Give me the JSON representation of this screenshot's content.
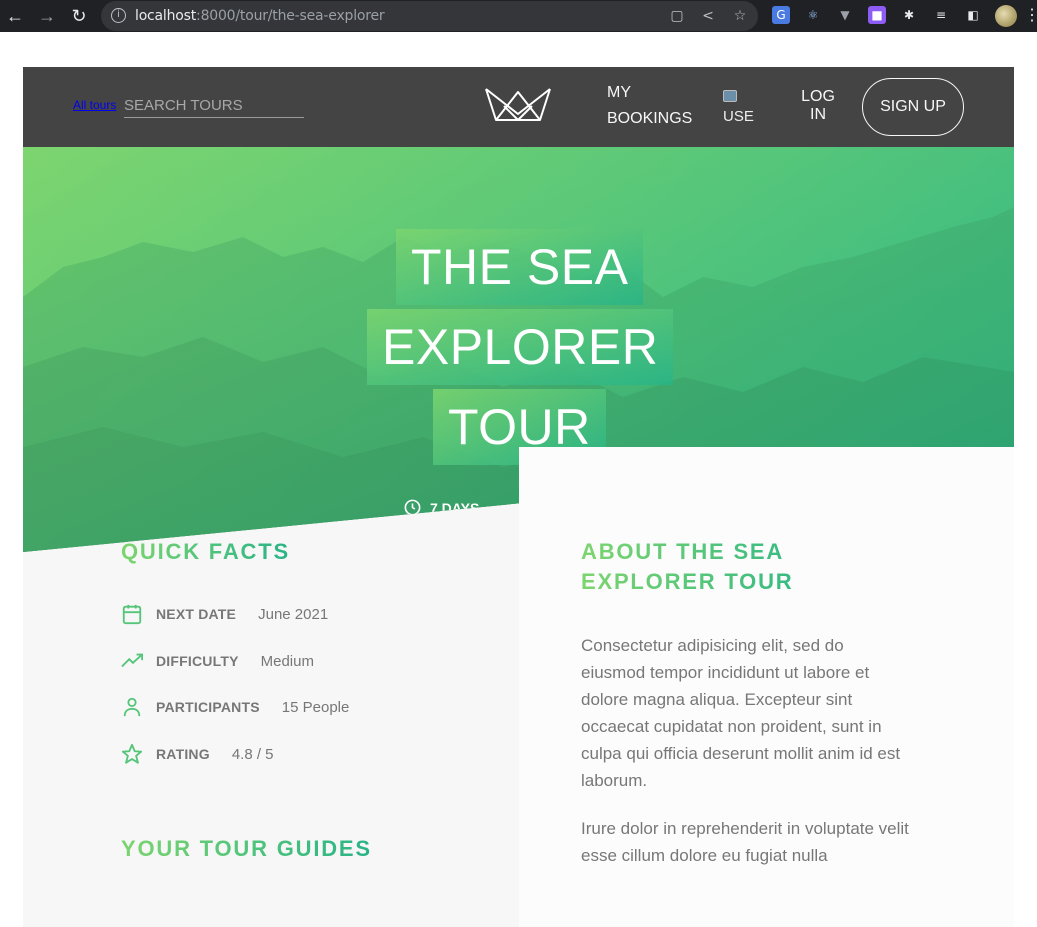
{
  "browser": {
    "url_host": "localhost",
    "url_path": ":8000/tour/the-sea-explorer"
  },
  "header": {
    "all_tours_link": "All tours",
    "search_placeholder": "SEARCH TOURS",
    "my_bookings": "MY BOOKINGS",
    "user_photo_alt": "USE",
    "login": "LOG IN",
    "signup": "SIGN UP"
  },
  "hero": {
    "title_lines": [
      "THE SEA",
      "EXPLORER",
      "TOUR"
    ],
    "duration": "7 DAYS",
    "location": ""
  },
  "quick_facts": {
    "heading": "QUICK FACTS",
    "items": [
      {
        "icon": "calendar-icon",
        "label": "NEXT DATE",
        "value": "June 2021"
      },
      {
        "icon": "trending-up-icon",
        "label": "DIFFICULTY",
        "value": "Medium"
      },
      {
        "icon": "user-icon",
        "label": "PARTICIPANTS",
        "value": "15 People"
      },
      {
        "icon": "star-icon",
        "label": "RATING",
        "value": "4.8 / 5"
      }
    ]
  },
  "guides": {
    "heading": "YOUR TOUR GUIDES"
  },
  "about": {
    "heading": "ABOUT THE SEA EXPLORER TOUR",
    "paragraphs": [
      "Consectetur adipisicing elit, sed do eiusmod tempor incididunt ut labore et dolore magna aliqua. Excepteur sint occaecat cupidatat non proident, sunt in culpa qui officia deserunt mollit anim id est laborum.",
      "Irure dolor in reprehenderit in voluptate velit esse cillum dolore eu fugiat nulla"
    ]
  },
  "colors": {
    "brand_green_light": "#7dd56f",
    "brand_green_dark": "#28b487",
    "header_bg": "#444444",
    "text_gray": "#777777"
  }
}
